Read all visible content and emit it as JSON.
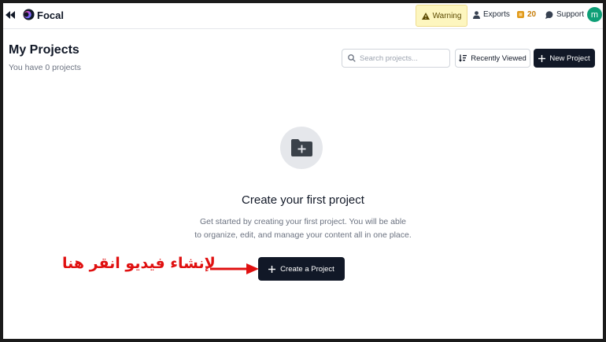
{
  "app": {
    "name": "Focal"
  },
  "topbar": {
    "warning_label": "Warning",
    "exports_label": "Exports",
    "credits_count": "20",
    "support_label": "Support",
    "avatar_initial": "m"
  },
  "header": {
    "title": "My Projects",
    "subtitle": "You have 0 projects",
    "search_placeholder": "Search projects...",
    "sort_label": "Recently Viewed",
    "new_project_label": "New Project"
  },
  "empty_state": {
    "title": "Create your first project",
    "description_line1": "Get started by creating your first project. You will be able",
    "description_line2": "to organize, edit, and manage your content all in one place.",
    "button_label": "Create a Project"
  },
  "annotation": {
    "text": "لإنشاء فيديو انقر هنا"
  },
  "colors": {
    "primary_dark": "#111827",
    "warning_bg": "#fdf6bf",
    "avatar_bg": "#0e9f77",
    "credits": "#c77d08",
    "annotation_red": "#e01010"
  }
}
